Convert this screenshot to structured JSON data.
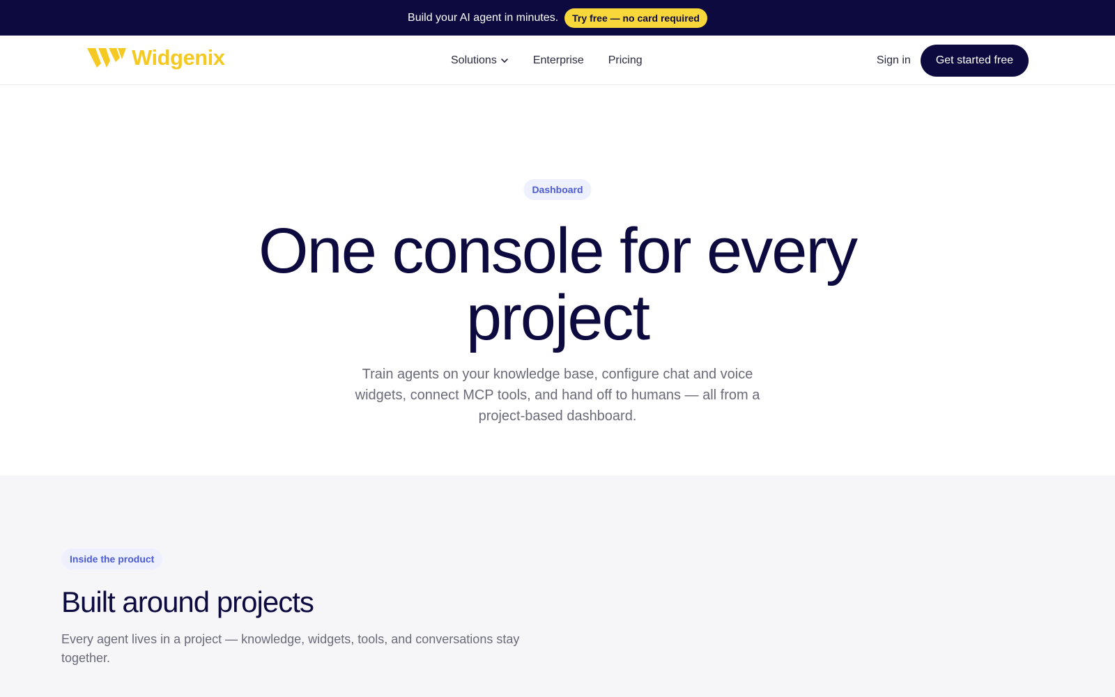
{
  "announcement": {
    "text": "Build your AI agent in minutes.",
    "cta": "Try free — no card required"
  },
  "nav": {
    "brand": "Widgenix",
    "links": [
      "Solutions",
      "Enterprise",
      "Pricing"
    ],
    "sign_in": "Sign in",
    "cta": "Get started free"
  },
  "hero": {
    "badge": "Dashboard",
    "title": "One console for every project",
    "subtitle": "Train agents on your knowledge base, configure chat and voice widgets, connect MCP tools, and hand off to humans — all from a project-based dashboard."
  },
  "section": {
    "badge": "Inside the product",
    "title": "Built around projects",
    "subtitle": "Every agent lives in a project — knowledge, widgets, tools, and conversations stay together."
  },
  "colors": {
    "navy": "#0c0a3e",
    "accent_yellow": "#f8d73a",
    "logo_yellow": "#f4c922",
    "badge_blue": "#4a5bd4",
    "badge_bg": "#eef0fd"
  },
  "icons": [
    "widgenix-logo-icon",
    "chevron-down-icon"
  ]
}
